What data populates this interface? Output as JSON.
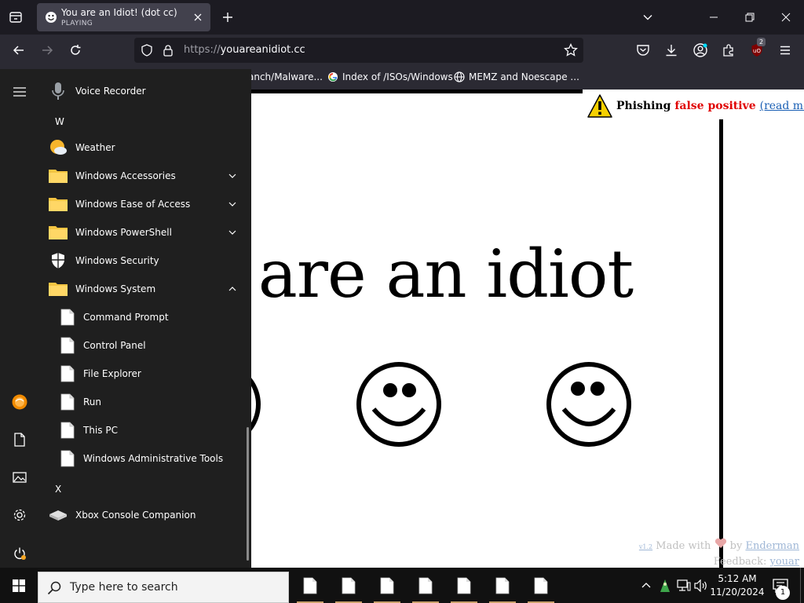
{
  "browser": {
    "tab": {
      "title": "You are an Idiot! (dot cc)",
      "status": "PLAYING"
    },
    "url": {
      "scheme": "https://",
      "host": "youareanidiot.cc"
    },
    "extension_badge": "2",
    "bookmarks": [
      {
        "label": "anch/Malware...",
        "icon": "folder-icon"
      },
      {
        "label": "Index of /ISOs/Windows",
        "icon": "google-icon"
      },
      {
        "label": "MEMZ and Noescape ...",
        "icon": "globe-icon"
      }
    ]
  },
  "page": {
    "headline": "u are an idiot",
    "phishing": {
      "word": "Phishing",
      "false_positive": "false positive",
      "link": "(read more)"
    },
    "credits": {
      "version": "v1.2",
      "made_with": "Made with",
      "by": "by",
      "author": "Enderman",
      "feedback_label": "Feedback:",
      "feedback_email": "youar    @enderman.ch"
    }
  },
  "start_menu": {
    "apps": [
      {
        "label": "Voice Recorder",
        "icon": "microphone-icon"
      },
      {
        "letter": "W"
      },
      {
        "label": "Weather",
        "icon": "weather-icon"
      },
      {
        "label": "Windows Accessories",
        "icon": "folder-icon",
        "expand": "down"
      },
      {
        "label": "Windows Ease of Access",
        "icon": "folder-icon",
        "expand": "down"
      },
      {
        "label": "Windows PowerShell",
        "icon": "folder-icon",
        "expand": "down"
      },
      {
        "label": "Windows Security",
        "icon": "shield-icon"
      },
      {
        "label": "Windows System",
        "icon": "folder-icon",
        "expand": "up"
      },
      {
        "label": "Command Prompt",
        "icon": "file-icon",
        "sub": true
      },
      {
        "label": "Control Panel",
        "icon": "file-icon",
        "sub": true
      },
      {
        "label": "File Explorer",
        "icon": "file-icon",
        "sub": true
      },
      {
        "label": "Run",
        "icon": "file-icon",
        "sub": true
      },
      {
        "label": "This PC",
        "icon": "file-icon",
        "sub": true
      },
      {
        "label": "Windows Administrative Tools",
        "icon": "file-icon",
        "sub": true
      },
      {
        "letter": "X"
      },
      {
        "label": "Xbox Console Companion",
        "icon": "xbox-icon"
      }
    ]
  },
  "taskbar": {
    "search_placeholder": "Type here to search",
    "time": "5:12 AM",
    "date": "11/20/2024",
    "notification_count": "1",
    "pinned_count": 7
  },
  "colors": {
    "tab_active": "#42414d",
    "chrome_bg": "#1c1b22",
    "toolbar_bg": "#2b2a33",
    "start_bg": "#1f1f1f",
    "folder": "#f5c542",
    "phishing_red": "#e00000"
  }
}
